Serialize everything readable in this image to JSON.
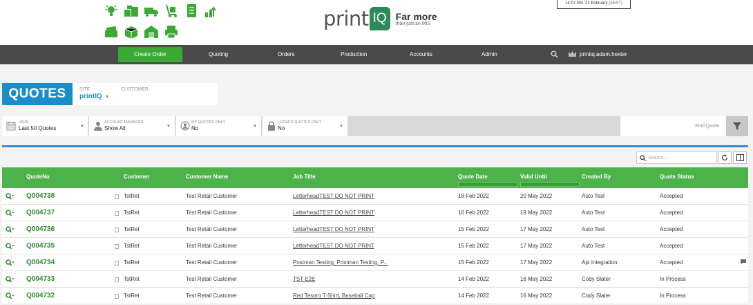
{
  "header": {
    "logo_word": "print",
    "logo_mark": "IQ",
    "tagline_main": "Far more",
    "tagline_sub": "than just an MIS",
    "clock_time": "14:07 PM",
    "clock_date": "21 February",
    "clock_tz": "(AEST)",
    "icons": [
      "lightbulb-icon",
      "boxes-icon",
      "truck-icon",
      "trolley-icon",
      "document-stack-icon",
      "growth-chart-icon",
      "paper-roll-icon",
      "package-icon",
      "warehouse-icon",
      "printer-icon"
    ]
  },
  "nav": {
    "create_order": "Create Order",
    "items": [
      "Quoting",
      "Orders",
      "Production",
      "Accounts",
      "Admin"
    ],
    "user": "printiq.adam.hexter"
  },
  "page": {
    "title": "QUOTES",
    "site_label": "SITE",
    "site_value": "printIQ",
    "customer_label": "CUSTOMER"
  },
  "filters": {
    "view_label": "VIEW",
    "view_value": "Last 50 Quotes",
    "manager_label": "ACCOUNT MANAGER",
    "manager_value": "Show All",
    "myquotes_label": "MY QUOTES ONLY",
    "myquotes_value": "No",
    "locked_label": "LOCKED QUOTES ONLY",
    "locked_value": "No",
    "find_quote": "Find Quote"
  },
  "table": {
    "search_placeholder": "Search ...",
    "headers": [
      "QuoteNo",
      "Customer",
      "Customer Name",
      "Job Title",
      "Quote Date",
      "Valid Until",
      "Created By",
      "Quote Status"
    ],
    "rows": [
      {
        "quote_no": "Q004738",
        "customer": "TstRet",
        "customer_name": "Test Retail Customer",
        "job_title": "LetterheadTEST DO NOT PRINT",
        "quote_date": "18 Feb 2022",
        "valid_until": "20 May 2022",
        "created_by": "Auto Test",
        "status": "Accepted"
      },
      {
        "quote_no": "Q004737",
        "customer": "TstRet",
        "customer_name": "Test Retail Customer",
        "job_title": "LetterheadTEST DO NOT PRINT",
        "quote_date": "16 Feb 2022",
        "valid_until": "19 May 2022",
        "created_by": "Auto Test",
        "status": "Accepted"
      },
      {
        "quote_no": "Q004736",
        "customer": "TstRet",
        "customer_name": "Test Retail Customer",
        "job_title": "LetterheadTEST DO NOT PRINT",
        "quote_date": "15 Feb 2022",
        "valid_until": "17 May 2022",
        "created_by": "Auto Test",
        "status": "Accepted"
      },
      {
        "quote_no": "Q004735",
        "customer": "TstRet",
        "customer_name": "Test Retail Customer",
        "job_title": "LetterheadTEST DO NOT PRINT",
        "quote_date": "15 Feb 2022",
        "valid_until": "17 May 2022",
        "created_by": "Auto Test",
        "status": "Accepted"
      },
      {
        "quote_no": "Q004734",
        "customer": "TstRet",
        "customer_name": "Test Retail Customer",
        "job_title": "Postman Testing, Postman Testing, P...",
        "quote_date": "15 Feb 2022",
        "valid_until": "17 May 2022",
        "created_by": "Api Integration",
        "status": "Accepted"
      },
      {
        "quote_no": "Q004733",
        "customer": "TstRet",
        "customer_name": "Test Retail Customer",
        "job_title": "TST E2E",
        "quote_date": "14 Feb 2022",
        "valid_until": "16 May 2022",
        "created_by": "Cody Slater",
        "status": "In Process"
      },
      {
        "quote_no": "Q004732",
        "customer": "TstRet",
        "customer_name": "Test Retail Customer",
        "job_title": "Red Tesoro T-Shirt, Baseball Cap",
        "quote_date": "14 Feb 2022",
        "valid_until": "16 May 2022",
        "created_by": "Cody Slater",
        "status": "In Process"
      }
    ]
  },
  "colors": {
    "brand_green": "#3aaa35",
    "header_green": "#4bb34a",
    "quotes_blue": "#1b8ec9",
    "nav_dark": "#4a4a4a"
  }
}
